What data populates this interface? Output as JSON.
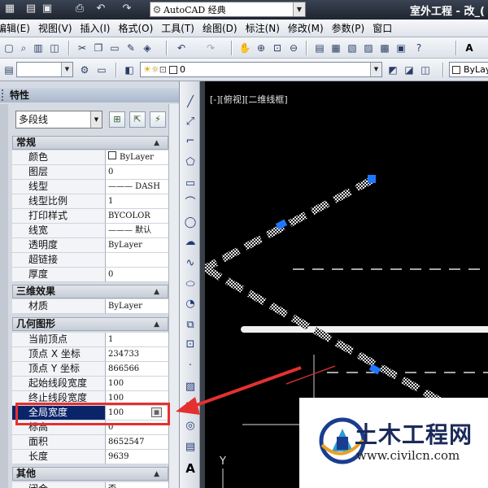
{
  "titlebar": {
    "workspace": "AutoCAD 经典",
    "title": "室外工程 - 改_("
  },
  "menubar": {
    "items": [
      "编辑(E)",
      "视图(V)",
      "插入(I)",
      "格式(O)",
      "工具(T)",
      "绘图(D)",
      "标注(N)",
      "修改(M)",
      "参数(P)",
      "窗口"
    ]
  },
  "layer_toolbar": {
    "layer_value": "0",
    "color_value": "ByLay"
  },
  "properties": {
    "title": "特性",
    "object_type": "多段线",
    "sections": {
      "general": {
        "label": "常规",
        "rows": [
          {
            "label": "颜色",
            "value": "ByLayer"
          },
          {
            "label": "图层",
            "value": "0"
          },
          {
            "label": "线型",
            "value": "——— DASH"
          },
          {
            "label": "线型比例",
            "value": "1"
          },
          {
            "label": "打印样式",
            "value": "BYCOLOR"
          },
          {
            "label": "线宽",
            "value": "——— 默认"
          },
          {
            "label": "透明度",
            "value": "ByLayer"
          },
          {
            "label": "超链接",
            "value": ""
          },
          {
            "label": "厚度",
            "value": "0"
          }
        ]
      },
      "three_d": {
        "label": "三维效果",
        "rows": [
          {
            "label": "材质",
            "value": "ByLayer"
          }
        ]
      },
      "geometry": {
        "label": "几何图形",
        "rows": [
          {
            "label": "当前顶点",
            "value": "1"
          },
          {
            "label": "顶点 X 坐标",
            "value": "234733"
          },
          {
            "label": "顶点 Y 坐标",
            "value": "866566"
          },
          {
            "label": "起始线段宽度",
            "value": "100"
          },
          {
            "label": "终止线段宽度",
            "value": "100"
          },
          {
            "label": "全局宽度",
            "value": "100"
          },
          {
            "label": "标高",
            "value": "0"
          },
          {
            "label": "面积",
            "value": "8652547"
          },
          {
            "label": "长度",
            "value": "9639"
          }
        ]
      },
      "misc": {
        "label": "其他",
        "rows": [
          {
            "label": "闭合",
            "value": "否"
          }
        ]
      }
    }
  },
  "canvas": {
    "viewport_label": "[-][俯视][二维线框]",
    "ucs_y": "Y"
  },
  "watermark": {
    "title": "土木工程网",
    "url": "www.civilcn.com"
  },
  "colors": {
    "selected_row": "#0a246a",
    "highlight": "#e53030",
    "grip": "#1e78ff"
  }
}
